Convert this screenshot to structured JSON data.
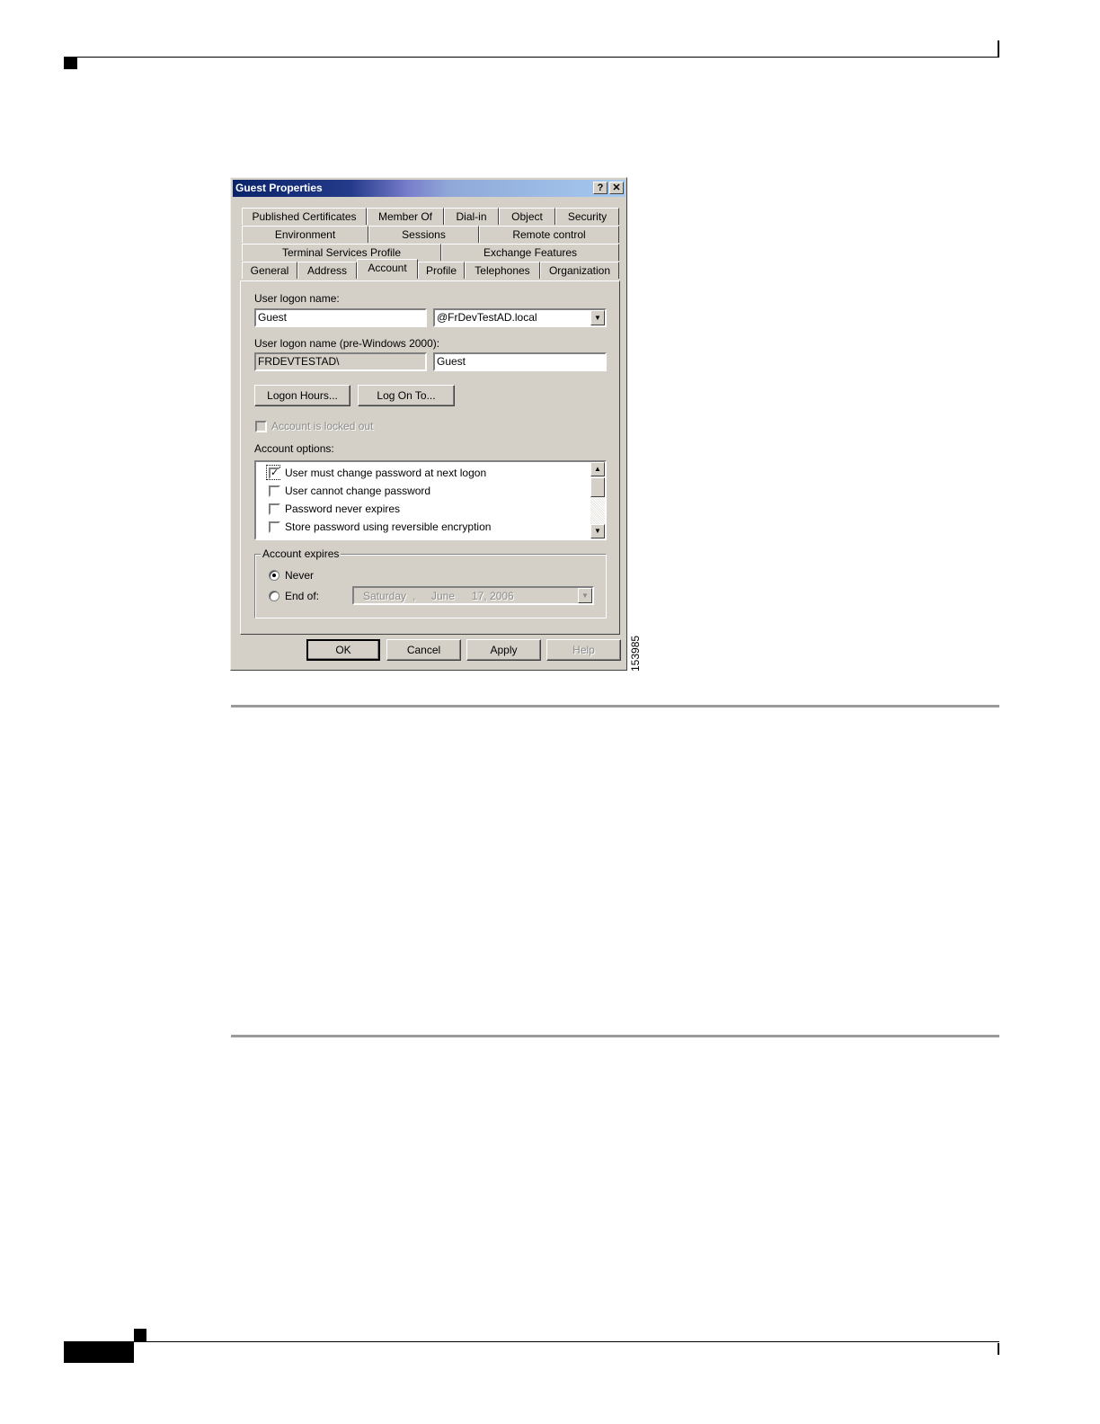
{
  "figure_number": "153985",
  "dialog": {
    "title": "Guest Properties",
    "help_button": "?",
    "close_button": "✕",
    "tabs_row1": [
      "Published Certificates",
      "Member Of",
      "Dial-in",
      "Object",
      "Security"
    ],
    "tabs_row2": [
      "Environment",
      "Sessions",
      "Remote control"
    ],
    "tabs_row3": [
      "Terminal Services Profile",
      "Exchange Features"
    ],
    "tabs_row4": [
      "General",
      "Address",
      "Account",
      "Profile",
      "Telephones",
      "Organization"
    ],
    "active_tab": "Account",
    "account": {
      "logon_name_label": "User logon name:",
      "logon_name_value": "Guest",
      "domain_value": "@FrDevTestAD.local",
      "prewin_label": "User logon name (pre-Windows 2000):",
      "prewin_domain_value": "FRDEVTESTAD\\",
      "prewin_name_value": "Guest",
      "logon_hours_button": "Logon Hours...",
      "log_on_to_button": "Log On To...",
      "locked_out_label": "Account is locked out",
      "options_label": "Account options:",
      "options": [
        {
          "label": "User must change password at next logon",
          "checked": true
        },
        {
          "label": "User cannot change password",
          "checked": false
        },
        {
          "label": "Password never expires",
          "checked": false
        },
        {
          "label": "Store password using reversible encryption",
          "checked": false
        }
      ],
      "expires_label": "Account expires",
      "never_label": "Never",
      "end_of_label": "End of:",
      "end_of_date": {
        "weekday": "Saturday",
        "sep": ",",
        "month": "June",
        "day_year": "17, 2006"
      },
      "selected_expiry": "Never"
    },
    "buttons": {
      "ok": "OK",
      "cancel": "Cancel",
      "apply": "Apply",
      "help": "Help"
    }
  }
}
